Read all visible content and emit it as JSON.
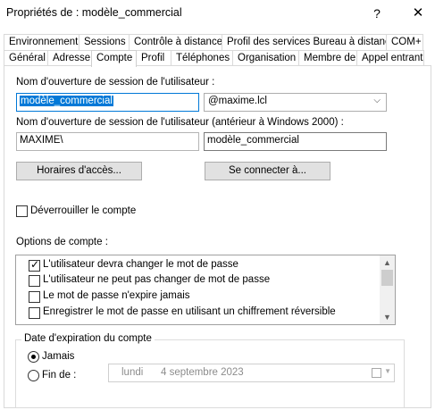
{
  "window": {
    "title": "Propriétés de : modèle_commercial",
    "help_label": "?",
    "close_label": "✕"
  },
  "tabs_row1": [
    {
      "label": "Environnement"
    },
    {
      "label": "Sessions"
    },
    {
      "label": "Contrôle à distance"
    },
    {
      "label": "Profil des services Bureau à distance"
    },
    {
      "label": "COM+"
    }
  ],
  "tabs_row2": [
    {
      "label": "Général"
    },
    {
      "label": "Adresse"
    },
    {
      "label": "Compte",
      "active": true
    },
    {
      "label": "Profil"
    },
    {
      "label": "Téléphones"
    },
    {
      "label": "Organisation"
    },
    {
      "label": "Membre de"
    },
    {
      "label": "Appel entrant"
    }
  ],
  "account": {
    "logon_label": "Nom d'ouverture de session de l'utilisateur :",
    "logon_value": "modèle_commercial",
    "domain_value": "@maxime.lcl",
    "pre2000_label": "Nom d'ouverture de session de l'utilisateur (antérieur à Windows 2000) :",
    "pre2000_domain": "MAXIME\\",
    "pre2000_user": "modèle_commercial",
    "hours_button": "Horaires d'accès...",
    "logon_to_button": "Se connecter à...",
    "unlock_label": "Déverrouiller le compte",
    "unlock_checked": false
  },
  "options": {
    "label": "Options de compte :",
    "items": [
      {
        "label": "L'utilisateur devra changer le mot de passe",
        "checked": true
      },
      {
        "label": "L'utilisateur ne peut pas changer de mot de passe",
        "checked": false
      },
      {
        "label": "Le mot de passe n'expire jamais",
        "checked": false
      },
      {
        "label": "Enregistrer le mot de passe en utilisant un chiffrement réversible",
        "checked": false
      }
    ]
  },
  "expiration": {
    "title": "Date d'expiration du compte",
    "never_label": "Jamais",
    "never_selected": true,
    "end_label": "Fin de :",
    "end_selected": false,
    "day": "lundi",
    "date": "4 septembre 2023"
  }
}
